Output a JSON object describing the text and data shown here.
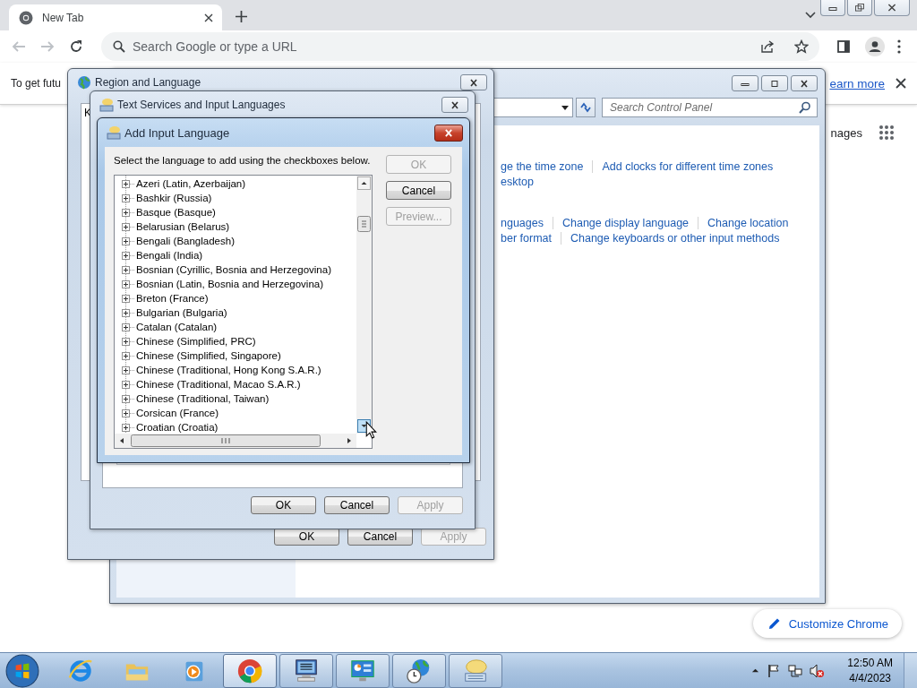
{
  "browser": {
    "tab": {
      "title": "New Tab"
    },
    "omnibox": {
      "placeholder": "Search Google or type a URL"
    },
    "infobar": {
      "text": "To get futu",
      "link": "earn more"
    },
    "page": {
      "link": "nages",
      "button": "Customize Chrome"
    }
  },
  "control_panel": {
    "search": {
      "placeholder": "Search Control Panel"
    },
    "link_rows": [
      [
        "ge the time zone",
        "Add clocks for different time zones"
      ],
      [
        "esktop"
      ],
      [
        "nguages",
        "Change display language",
        "Change location"
      ],
      [
        "ber format",
        "Change keyboards or other input methods"
      ]
    ]
  },
  "region_window": {
    "title": "Region and Language",
    "tab_label": "K",
    "buttons": [
      {
        "label": "OK",
        "disabled": false
      },
      {
        "label": "Cancel",
        "disabled": false
      },
      {
        "label": "Apply",
        "disabled": true
      }
    ]
  },
  "text_services_window": {
    "title": "Text Services and Input Languages",
    "buttons": [
      {
        "label": "OK",
        "disabled": false
      },
      {
        "label": "Cancel",
        "disabled": false
      },
      {
        "label": "Apply",
        "disabled": true
      }
    ]
  },
  "add_language_dialog": {
    "title": "Add Input Language",
    "instruction": "Select the language to add using the checkboxes below.",
    "buttons": [
      {
        "label": "OK",
        "disabled": true
      },
      {
        "label": "Cancel",
        "disabled": false
      },
      {
        "label": "Preview...",
        "disabled": true
      }
    ],
    "languages": [
      {
        "name": "Azeri (Latin, Azerbaijan)",
        "expanded": false
      },
      {
        "name": "Bashkir (Russia)",
        "expanded": false
      },
      {
        "name": "Basque (Basque)",
        "expanded": false
      },
      {
        "name": "Belarusian (Belarus)",
        "expanded": false
      },
      {
        "name": "Bengali (Bangladesh)",
        "expanded": false
      },
      {
        "name": "Bengali (India)",
        "expanded": false
      },
      {
        "name": "Bosnian (Cyrillic, Bosnia and Herzegovina)",
        "expanded": false
      },
      {
        "name": "Bosnian (Latin, Bosnia and Herzegovina)",
        "expanded": false
      },
      {
        "name": "Breton (France)",
        "expanded": false
      },
      {
        "name": "Bulgarian (Bulgaria)",
        "expanded": false
      },
      {
        "name": "Catalan (Catalan)",
        "expanded": false
      },
      {
        "name": "Chinese (Simplified, PRC)",
        "expanded": false
      },
      {
        "name": "Chinese (Simplified, Singapore)",
        "expanded": false
      },
      {
        "name": "Chinese (Traditional, Hong Kong S.A.R.)",
        "expanded": false
      },
      {
        "name": "Chinese (Traditional, Macao S.A.R.)",
        "expanded": false
      },
      {
        "name": "Chinese (Traditional, Taiwan)",
        "expanded": false
      },
      {
        "name": "Corsican (France)",
        "expanded": false
      },
      {
        "name": "Croatian (Croatia)",
        "expanded": false
      }
    ]
  },
  "taskbar": {
    "apps": [
      {
        "kind": "browser",
        "running": false,
        "selected": false
      },
      {
        "kind": "folder",
        "running": false,
        "selected": false
      },
      {
        "kind": "media",
        "running": false,
        "selected": false
      },
      {
        "kind": "chrome",
        "running": true,
        "selected": true
      },
      {
        "kind": "keyboard",
        "running": true,
        "selected": false
      },
      {
        "kind": "control",
        "running": true,
        "selected": false
      },
      {
        "kind": "globe",
        "running": true,
        "selected": false
      },
      {
        "kind": "speech",
        "running": true,
        "selected": false
      }
    ],
    "clock": {
      "time": "12:50 AM",
      "date": "4/4/2023"
    }
  }
}
